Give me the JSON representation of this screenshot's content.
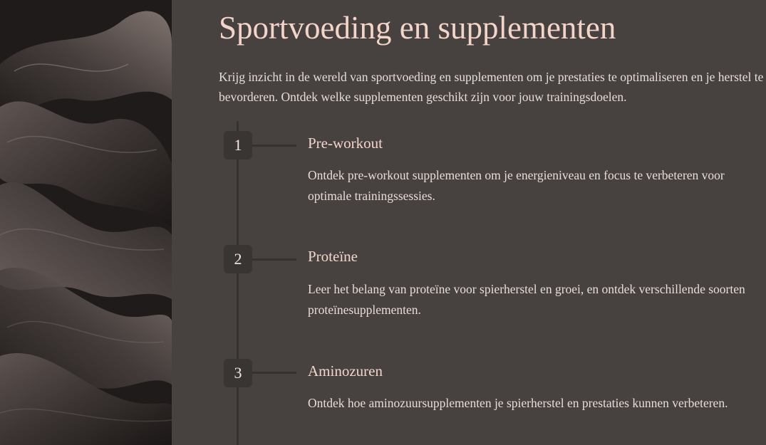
{
  "page": {
    "title": "Sportvoeding en supplementen",
    "intro": "Krijg inzicht in de wereld van sportvoeding en supplementen om je prestaties te optimaliseren en je herstel te bevorderen. Ontdek welke supplementen geschikt zijn voor jouw trainingsdoelen."
  },
  "steps": [
    {
      "number": "1",
      "title": "Pre-workout",
      "description": "Ontdek pre-workout supplementen om je energieniveau en focus te verbeteren voor optimale trainingssessies."
    },
    {
      "number": "2",
      "title": "Proteïne",
      "description": "Leer het belang van proteïne voor spierherstel en groei, en ontdek verschillende soorten proteïnesupplementen."
    },
    {
      "number": "3",
      "title": "Aminozuren",
      "description": "Ontdek hoe aminozuursupplementen je spierherstel en prestaties kunnen verbeteren."
    }
  ],
  "colors": {
    "background": "#47413f",
    "accent_title": "#f3d4c8",
    "body_text": "#e9ddd8",
    "step_badge": "#393533",
    "timeline": "#363230",
    "side_panel": "#221e1d"
  },
  "icons": {
    "side_image": "abstract-dark-silk-waves-image"
  }
}
